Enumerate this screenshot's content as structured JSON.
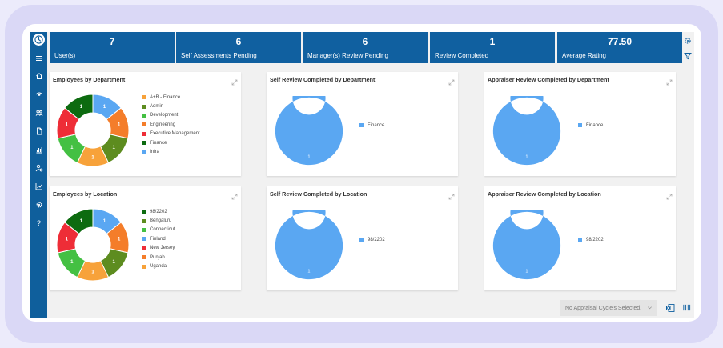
{
  "sidebar": {
    "items": [
      {
        "icon": "home-icon"
      },
      {
        "icon": "eye-icon"
      },
      {
        "icon": "users-icon"
      },
      {
        "icon": "document-icon"
      },
      {
        "icon": "bar-chart-icon"
      },
      {
        "icon": "person-gear-icon"
      },
      {
        "icon": "trend-icon"
      },
      {
        "icon": "gear-icon"
      },
      {
        "icon": "help-icon",
        "label": "?"
      }
    ]
  },
  "kpis": [
    {
      "value": "7",
      "label": "User(s)"
    },
    {
      "value": "6",
      "label": "Self Assessments Pending"
    },
    {
      "value": "6",
      "label": "Manager(s) Review Pending"
    },
    {
      "value": "1",
      "label": "Review Completed"
    },
    {
      "value": "77.50",
      "label": "Average Rating"
    }
  ],
  "colors": {
    "blue": "#5aa7f2",
    "orange": "#f7a23a",
    "olive": "#5d8c1f",
    "green": "#44c043",
    "red": "#ee2d37",
    "darkgreen": "#0d6b10",
    "navy": "#1060a0",
    "darkorange": "#f47d2a"
  },
  "cards": {
    "emp_dept": {
      "title": "Employees by Department"
    },
    "self_dept": {
      "title": "Self Review Completed by Department"
    },
    "appr_dept": {
      "title": "Appraiser Review Completed by Department"
    },
    "emp_loc": {
      "title": "Employees by Location"
    },
    "self_loc": {
      "title": "Self Review Completed by Location"
    },
    "appr_loc": {
      "title": "Appraiser Review Completed by Location"
    }
  },
  "footer": {
    "cycle_placeholder": "No Appraisal Cycle's Selected."
  },
  "chart_data": [
    {
      "type": "pie",
      "title": "Employees by Department",
      "labels": [
        "A+B - Finance...",
        "Admin",
        "Development",
        "Engineering",
        "Executive Management",
        "Finance",
        "Infra"
      ],
      "values": [
        1,
        1,
        1,
        1,
        1,
        1,
        1
      ],
      "colors": [
        "#f7a23a",
        "#5d8c1f",
        "#44c043",
        "#f47d2a",
        "#ee2d37",
        "#0d6b10",
        "#5aa7f2"
      ],
      "slice_order": [
        "Infra",
        "Engineering",
        "Admin",
        "A+B - Finance...",
        "Development",
        "Executive Management",
        "Finance"
      ],
      "legend": "right"
    },
    {
      "type": "pie",
      "title": "Self Review Completed by Department",
      "labels": [
        "Finance"
      ],
      "values": [
        1
      ],
      "colors": [
        "#5aa7f2"
      ],
      "legend": "right"
    },
    {
      "type": "pie",
      "title": "Appraiser Review Completed by Department",
      "labels": [
        "Finance"
      ],
      "values": [
        1
      ],
      "colors": [
        "#5aa7f2"
      ],
      "legend": "right"
    },
    {
      "type": "pie",
      "title": "Employees by Location",
      "labels": [
        "98/2202",
        "Bengaluru",
        "Connecticut",
        "Finland",
        "New Jersey",
        "Punjab",
        "Uganda"
      ],
      "values": [
        1,
        1,
        1,
        1,
        1,
        1,
        1
      ],
      "colors": [
        "#0d6b10",
        "#5d8c1f",
        "#44c043",
        "#5aa7f2",
        "#ee2d37",
        "#f47d2a",
        "#f7a23a"
      ],
      "slice_order": [
        "Finland",
        "Punjab",
        "Bengaluru",
        "Uganda",
        "Connecticut",
        "New Jersey",
        "98/2202"
      ],
      "legend": "right"
    },
    {
      "type": "pie",
      "title": "Self Review Completed by Location",
      "labels": [
        "98/2202"
      ],
      "values": [
        1
      ],
      "colors": [
        "#5aa7f2"
      ],
      "legend": "right"
    },
    {
      "type": "pie",
      "title": "Appraiser Review Completed by Location",
      "labels": [
        "98/2202"
      ],
      "values": [
        1
      ],
      "colors": [
        "#5aa7f2"
      ],
      "legend": "right"
    }
  ]
}
